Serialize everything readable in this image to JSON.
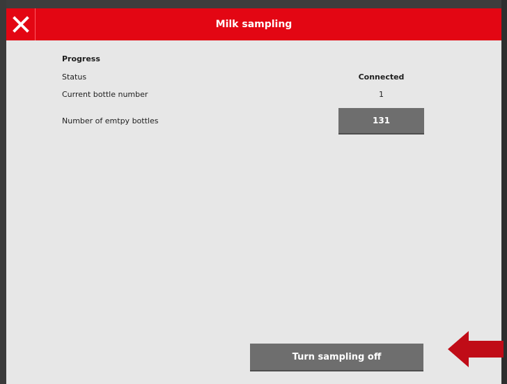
{
  "dialog": {
    "title": "Milk sampling",
    "close_icon": "close-icon"
  },
  "progress": {
    "heading": "Progress",
    "rows": [
      {
        "label": "Status",
        "value": "Connected"
      },
      {
        "label": "Current bottle number",
        "value": "1"
      },
      {
        "label": "Number of emtpy bottles",
        "value": "131"
      }
    ]
  },
  "actions": {
    "turn_off_label": "Turn sampling off"
  },
  "annotation": {
    "arrow_icon": "left-arrow-icon",
    "arrow_color": "#c00c17"
  },
  "colors": {
    "accent": "#e30613",
    "panel": "#e7e7e7",
    "button": "#6e6e6e"
  }
}
